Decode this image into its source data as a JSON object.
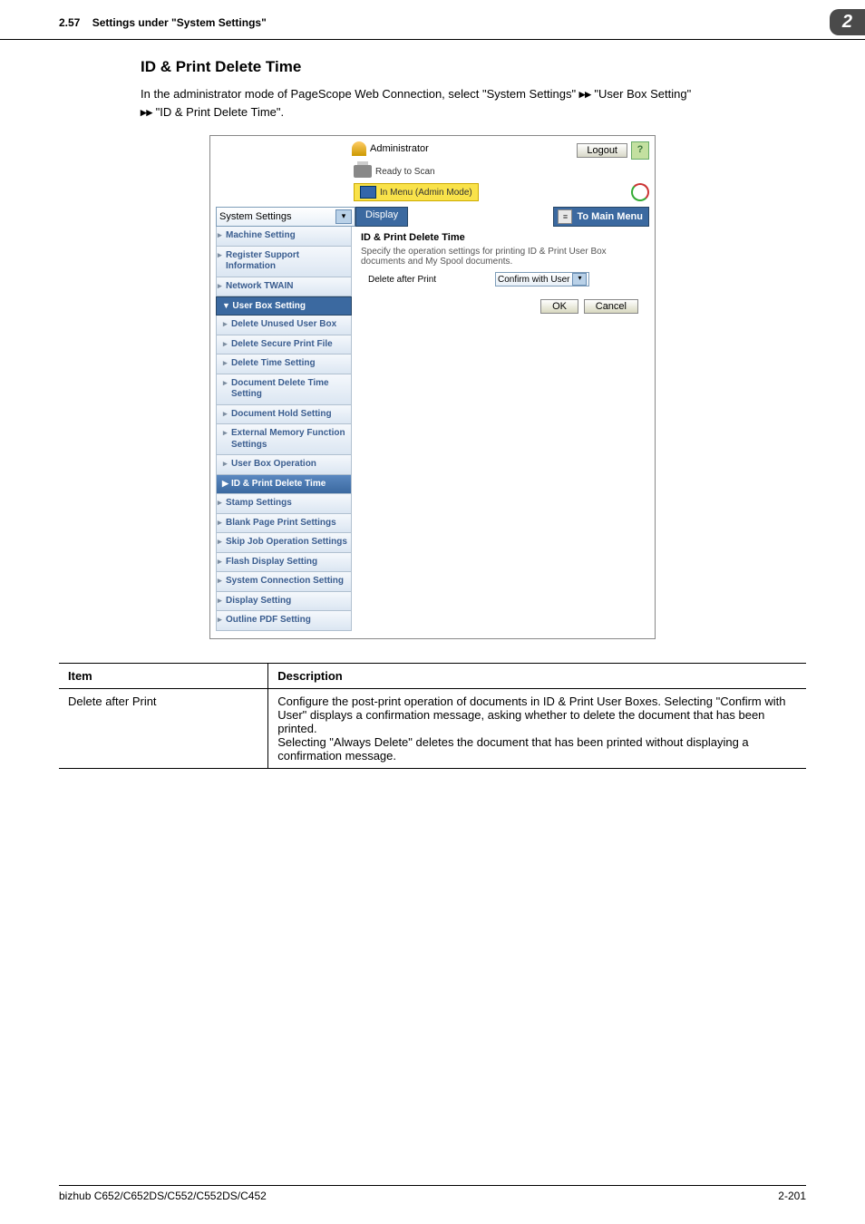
{
  "header": {
    "section_no": "2.57",
    "section_title": "Settings under \"System Settings\"",
    "page_tag": "2"
  },
  "body": {
    "h2": "ID & Print Delete Time",
    "intro_pre": "In the administrator mode of PageScope Web Connection, select \"System Settings\" ",
    "intro_mid": " \"User Box Setting\" ",
    "intro_post": " \"ID & Print Delete Time\".",
    "arrow": "▸▸"
  },
  "shot": {
    "admin": "Administrator",
    "logout": "Logout",
    "help": "?",
    "ready": "Ready to Scan",
    "menu_mode": "In Menu (Admin Mode)",
    "dropdown": "System Settings",
    "display_btn": "Display",
    "main_menu_btn": "To Main Menu",
    "side": {
      "machine": "Machine Setting",
      "register": "Register Support Information",
      "twain": "Network TWAIN",
      "userbox_header": "User Box Setting",
      "del_unused": "Delete Unused User Box",
      "del_secure": "Delete Secure Print File",
      "del_time": "Delete Time Setting",
      "doc_del": "Document Delete Time Setting",
      "doc_hold": "Document Hold Setting",
      "ext_mem": "External Memory Function Settings",
      "ub_op": "User Box Operation",
      "id_print": "ID & Print Delete Time",
      "stamp": "Stamp Settings",
      "blank": "Blank Page Print Settings",
      "skip": "Skip Job Operation Settings",
      "flash": "Flash Display Setting",
      "sysconn": "System Connection Setting",
      "display": "Display Setting",
      "outline": "Outline PDF Setting"
    },
    "main": {
      "title": "ID & Print Delete Time",
      "desc": "Specify the operation settings for printing ID & Print User Box documents and My Spool documents.",
      "row_lbl": "Delete after Print",
      "row_val": "Confirm with User",
      "ok": "OK",
      "cancel": "Cancel"
    }
  },
  "table": {
    "col1": "Item",
    "col2": "Description",
    "row1_item": "Delete after Print",
    "row1_desc": "Configure the post-print operation of documents in ID & Print User Boxes. Selecting \"Confirm with User\" displays a confirmation message, asking whether to delete the document that has been printed.\nSelecting \"Always Delete\" deletes the document that has been printed without displaying a confirmation message."
  },
  "footer": {
    "left": "bizhub C652/C652DS/C552/C552DS/C452",
    "right": "2-201"
  }
}
